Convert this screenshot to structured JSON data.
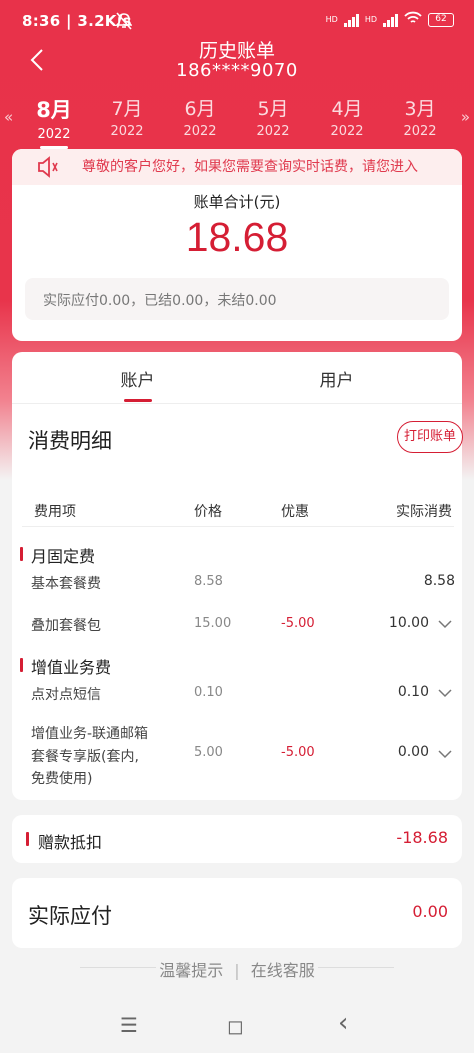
{
  "status": {
    "time": "8:36 | 3.2K/s",
    "hd1": "HD",
    "hd2": "HD",
    "battery": "62"
  },
  "header": {
    "title": "历史账单",
    "phone": "186****9070"
  },
  "months": [
    {
      "month": "8月",
      "year": "2022",
      "active": true
    },
    {
      "month": "7月",
      "year": "2022"
    },
    {
      "month": "6月",
      "year": "2022"
    },
    {
      "month": "5月",
      "year": "2022"
    },
    {
      "month": "4月",
      "year": "2022"
    },
    {
      "month": "3月",
      "year": "2022"
    }
  ],
  "nav_arrows": {
    "left": "«",
    "right": "»"
  },
  "notice": "尊敬的客户您好，如果您需要查询实时话费，请您进入",
  "summary": {
    "label": "账单合计(元)",
    "total": "18.68",
    "pay_line": "实际应付0.00，已结0.00，未结0.00"
  },
  "tabs": [
    "账户",
    "用户"
  ],
  "details": {
    "title": "消费明细",
    "print_button": "打印账单",
    "columns": [
      "费用项",
      "价格",
      "优惠",
      "实际消费"
    ],
    "groups": [
      {
        "name": "月固定费",
        "items": [
          {
            "name": "基本套餐费",
            "price": "8.58",
            "discount": "",
            "actual": "8.58"
          },
          {
            "name": "叠加套餐包",
            "price": "15.00",
            "discount": "-5.00",
            "actual": "10.00"
          }
        ]
      },
      {
        "name": "增值业务费",
        "items": [
          {
            "name": "点对点短信",
            "price": "0.10",
            "discount": "",
            "actual": "0.10"
          },
          {
            "name_lines": [
              "增值业务-联通邮箱",
              "套餐专享版(套内,",
              "免费使用)"
            ],
            "price": "5.00",
            "discount": "-5.00",
            "actual": "0.00"
          }
        ]
      }
    ]
  },
  "deduction": {
    "label": "赠款抵扣",
    "value": "-18.68"
  },
  "actual_pay": {
    "label": "实际应付",
    "value": "0.00"
  },
  "footer": {
    "tip": "温馨提示",
    "service": "在线客服",
    "sep": "|"
  },
  "system_nav": {
    "menu": "☰",
    "home": "◻",
    "back": "‹"
  },
  "colors": {
    "brand": "#e8324a",
    "accent": "#d51e34"
  }
}
